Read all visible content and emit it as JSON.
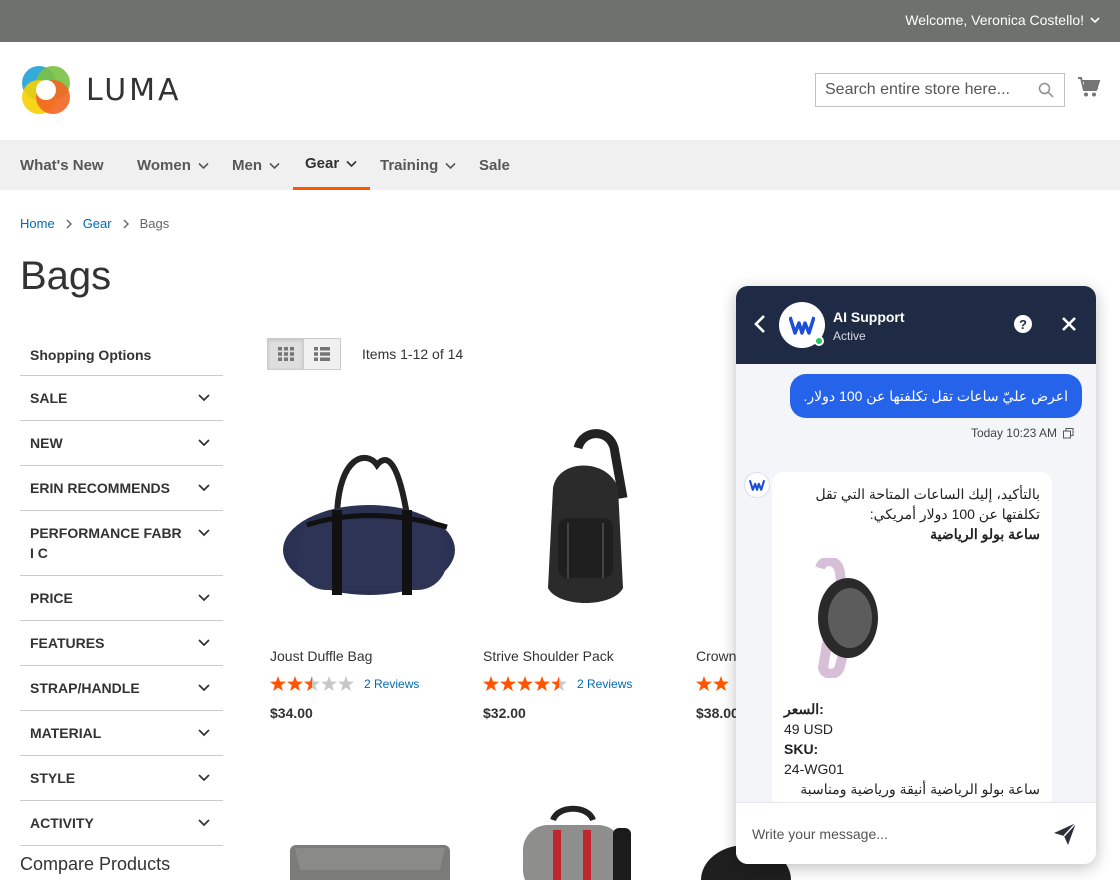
{
  "topbar": {
    "welcome": "Welcome, Veronica Costello!"
  },
  "header": {
    "logo_text": "LUMA",
    "search_placeholder": "Search entire store here..."
  },
  "nav": {
    "items": [
      {
        "label": "What's New"
      },
      {
        "label": "Women"
      },
      {
        "label": "Men"
      },
      {
        "label": "Gear"
      },
      {
        "label": "Training"
      },
      {
        "label": "Sale"
      }
    ]
  },
  "breadcrumb": {
    "home": "Home",
    "gear": "Gear",
    "current": "Bags"
  },
  "page_title": "Bags",
  "sidebar": {
    "title": "Shopping Options",
    "filters": [
      "SALE",
      "NEW",
      "ERIN RECOMMENDS",
      "PERFORMANCE FABRI C",
      "PRICE",
      "FEATURES",
      "STRAP/HANDLE",
      "MATERIAL",
      "STYLE",
      "ACTIVITY"
    ],
    "compare": "Compare Products"
  },
  "toolbar": {
    "items_count": "Items 1-12 of 14"
  },
  "products": [
    {
      "name": "Joust Duffle Bag",
      "reviews": "2  Reviews",
      "price": "$34.00",
      "rating_stars": 2.5
    },
    {
      "name": "Strive Shoulder Pack",
      "reviews": "2  Reviews",
      "price": "$32.00",
      "rating_stars": 4.5
    },
    {
      "name": "Crown",
      "price": "$38.00",
      "rating_stars": 2
    }
  ],
  "chat": {
    "agent_name": "AI Support",
    "agent_status": "Active",
    "user_message": "اعرض عليّ ساعات تقل تكلفتها عن 100 دولار.",
    "time": "Today 10:23 AM",
    "bot_line1": "بالتأكيد، إليك الساعات المتاحة التي تقل",
    "bot_line2": "تكلفتها عن 100 دولار أمريكي:",
    "bot_product_title": "ساعة بولو الرياضية",
    "price_label": "السعر:",
    "price_value": "49 USD",
    "sku_label": "SKU:",
    "sku_value": "24-WG01",
    "bot_description": "ساعة بولو الرياضية أنيقة ورياضية ومناسبة",
    "input_placeholder": "Write your message..."
  },
  "colors": {
    "accent_orange": "#ff5501",
    "link_blue": "#006bb4",
    "chat_header": "#1f2a44",
    "chat_user_bubble": "#2563eb",
    "star_color": "#ff5501"
  }
}
